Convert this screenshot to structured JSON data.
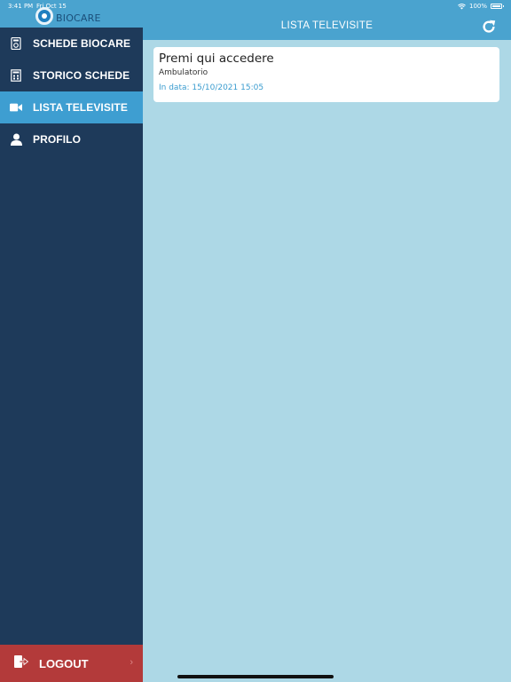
{
  "status_bar": {
    "time": "3:41 PM",
    "date": "Fri Oct 15",
    "battery": "100%"
  },
  "logo": {
    "text": "BIOCARE"
  },
  "sidebar": {
    "items": [
      {
        "label": "SCHEDE BIOCARE",
        "icon": "card-reader-icon",
        "active": false
      },
      {
        "label": "STORICO SCHEDE",
        "icon": "calendar-card-icon",
        "active": false
      },
      {
        "label": "LISTA TELEVISITE",
        "icon": "video-camera-icon",
        "active": true
      },
      {
        "label": "PROFILO",
        "icon": "user-icon",
        "active": false
      }
    ],
    "logout_label": "LOGOUT"
  },
  "header": {
    "title": "LISTA TELEVISITE",
    "refresh_icon": "refresh-icon"
  },
  "visits": [
    {
      "title": "Premi qui accedere",
      "location": "Ambulatorio",
      "date_label": "In data: 15/10/2021 15:05"
    }
  ],
  "colors": {
    "sidebar_bg": "#1e3a5a",
    "accent": "#4aa3cf",
    "active_item": "#3e9ed1",
    "content_bg": "#add8e6",
    "logout_bg": "#b33a3a",
    "date_text": "#3a9ccf"
  }
}
